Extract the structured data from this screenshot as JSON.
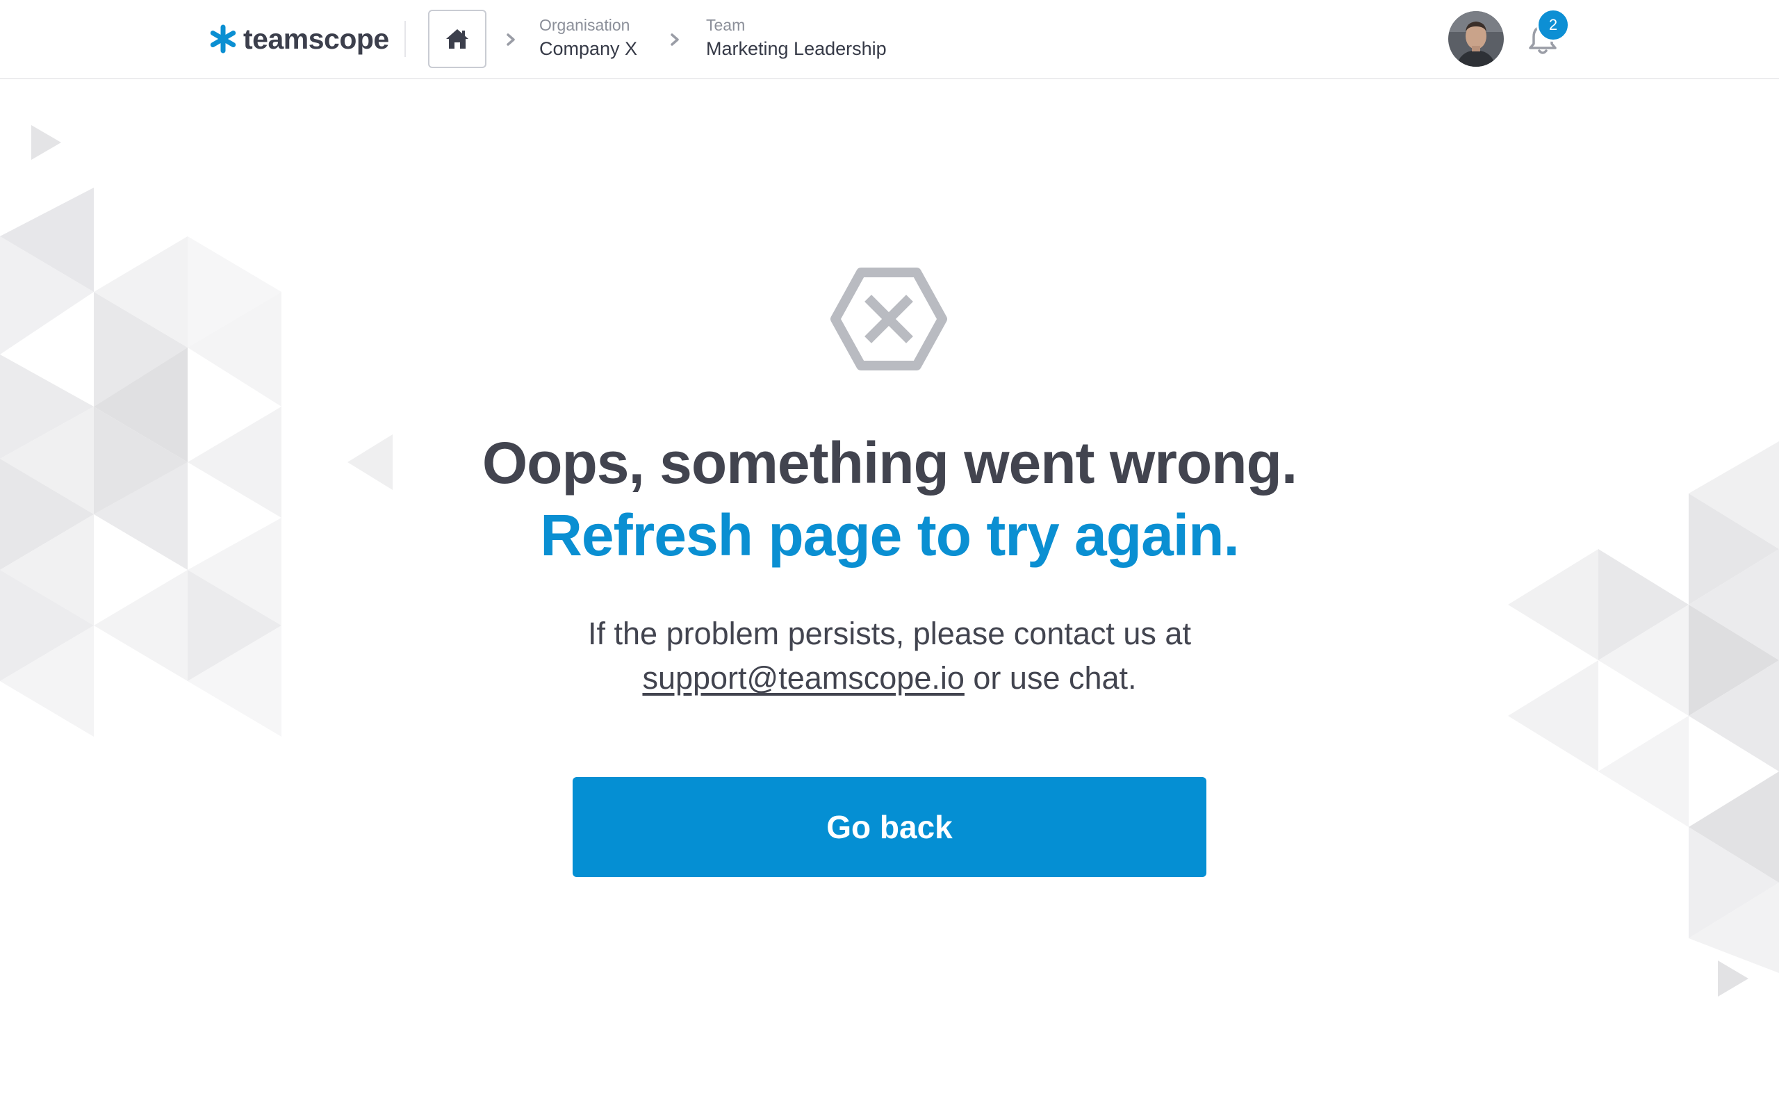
{
  "brand": {
    "name": "teamscope",
    "accent_color": "#0a8fd2",
    "logo_icon": "asterisk-logo-icon"
  },
  "header": {
    "home_icon": "home-icon",
    "breadcrumbs": [
      {
        "caption": "Organisation",
        "value": "Company X"
      },
      {
        "caption": "Team",
        "value": "Marketing Leadership"
      }
    ],
    "notifications": {
      "icon": "bell-icon",
      "count": "2"
    },
    "avatar_icon": "user-avatar"
  },
  "error": {
    "icon": "hexagon-x-icon",
    "title": "Oops, something went wrong.",
    "subtitle": "Refresh page to try again.",
    "message_before": "If the problem persists, please contact us at",
    "support_email": "support@teamscope.io",
    "message_after": "or use chat.",
    "button_label": "Go back"
  }
}
